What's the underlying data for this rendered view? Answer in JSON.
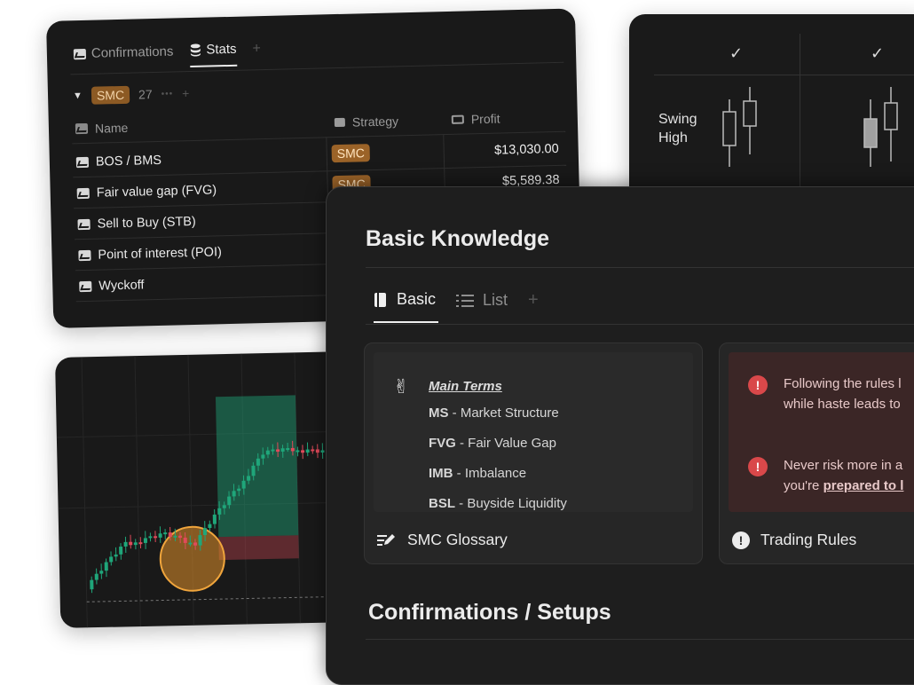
{
  "stats_panel": {
    "tabs": [
      {
        "label": "Confirmations",
        "icon": "chart-icon"
      },
      {
        "label": "Stats",
        "icon": "database-icon"
      }
    ],
    "add_tab": "+",
    "group": {
      "tag": "SMC",
      "count": "27",
      "more": "•••",
      "add": "+"
    },
    "columns": {
      "name": "Name",
      "strategy": "Strategy",
      "profit": "Profit"
    },
    "rows": [
      {
        "name": "BOS / BMS",
        "strategy": "SMC",
        "profit": "$13,030.00"
      },
      {
        "name": "Fair value gap (FVG)",
        "strategy": "SMC",
        "profit": "$5,589.38"
      },
      {
        "name": "Sell to Buy (STB)"
      },
      {
        "name": "Point of interest (POI)"
      },
      {
        "name": "Wyckoff"
      }
    ]
  },
  "swing_panel": {
    "checks": [
      "✓",
      "✓"
    ],
    "label_line1": "Swing",
    "label_line2": "High"
  },
  "main_panel": {
    "title": "Basic Knowledge",
    "tabs": [
      {
        "label": "Basic",
        "icon": "book-icon"
      },
      {
        "label": "List",
        "icon": "list-icon"
      }
    ],
    "add_tab": "+",
    "glossary": {
      "heading": "Main Terms",
      "icon": "peace-hand-icon",
      "terms": [
        {
          "abbr": "MS",
          "text": " - Market Structure"
        },
        {
          "abbr": "FVG",
          "text": " - Fair Value Gap"
        },
        {
          "abbr": "IMB",
          "text": " - Imbalance"
        },
        {
          "abbr": "BSL",
          "text": " - Buyside Liquidity"
        }
      ],
      "title": "SMC Glossary"
    },
    "rules": {
      "alerts": [
        {
          "line1": "Following the rules l",
          "line2": "while haste leads to"
        },
        {
          "line1": "Never risk more in a",
          "line2_prefix": "you're ",
          "line2_link": "prepared to l"
        }
      ],
      "title": "Trading Rules"
    },
    "section_title": "Confirmations / Setups"
  },
  "colors": {
    "accent_orange": "#9b6328",
    "bull_green": "#1fa67a",
    "bear_red": "#e04a5a",
    "alert_red": "#d9484a"
  }
}
